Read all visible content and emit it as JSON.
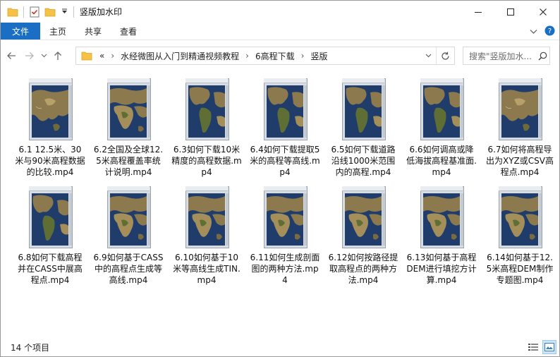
{
  "window": {
    "title": "竖版加水印"
  },
  "ribbon": {
    "tabs": [
      "文件",
      "主页",
      "共享",
      "查看"
    ]
  },
  "address": {
    "overflow": "«",
    "crumbs": [
      "水经微图从入门到精通视频教程",
      "6高程下载",
      "竖版"
    ]
  },
  "search": {
    "placeholder": "搜索\"竖版加水...",
    "icon": "search-icon"
  },
  "files": [
    {
      "name": "6.1 12.5米、30米与90米高程数据的比较.mp4",
      "map": "asia"
    },
    {
      "name": "6.2全国及全球12.5米高程覆盖率统计说明.mp4",
      "map": "africa"
    },
    {
      "name": "6.3如何下载10米精度的高程数据.mp4",
      "map": "americas"
    },
    {
      "name": "6.4如何下载提取5米的高程等高线.mp4",
      "map": "americas"
    },
    {
      "name": "6.5如何下载道路沿线1000米范围内的高程.mp4",
      "map": "americas"
    },
    {
      "name": "6.6如何调高或降低海拔高程基准面.mp4",
      "map": "americas"
    },
    {
      "name": "6.7如何将高程导出为XYZ或CSV高程点.mp4",
      "map": "asia"
    },
    {
      "name": "6.8如何下载高程并在CASS中展高程点.mp4",
      "map": "americas"
    },
    {
      "name": "6.9如何基于CASS中的高程点生成等高线.mp4",
      "map": "africa"
    },
    {
      "name": "6.10如何基于10米等高线生成TIN.mp4",
      "map": "africa"
    },
    {
      "name": "6.11如何生成剖面图的两种方法.mp4",
      "map": "africa"
    },
    {
      "name": "6.12如何按路径提取高程点的两种方法.mp4",
      "map": "africa"
    },
    {
      "name": "6.13如何基于高程DEM进行填挖方计算.mp4",
      "map": "africa"
    },
    {
      "name": "6.14如何基于12.5米高程DEM制作专题图.mp4",
      "map": "africa"
    }
  ],
  "status": {
    "count_text": "14 个项目"
  },
  "colors": {
    "file_tab": "#1a6fc4",
    "folder": "#f5c244",
    "ocean": "#1f3c6b",
    "land": "#8c7a4e"
  }
}
